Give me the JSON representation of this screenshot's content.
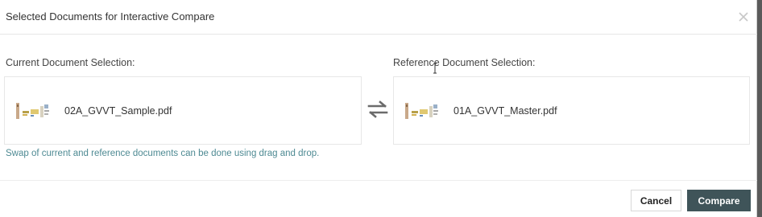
{
  "dialog": {
    "title": "Selected Documents for Interactive Compare",
    "close_icon": "close-icon"
  },
  "current": {
    "label": "Current Document Selection:",
    "file_name": "02A_GVVT_Sample.pdf"
  },
  "reference": {
    "label": "Reference Document Selection:",
    "file_name": "01A_GVVT_Master.pdf"
  },
  "swap_icon": "swap-arrows-icon",
  "hint": "Swap of current and reference documents can be done using drag and drop.",
  "buttons": {
    "cancel": "Cancel",
    "compare": "Compare"
  },
  "colors": {
    "hint_text": "#4e8a93",
    "compare_button": "#3f5459",
    "backdrop": "#5a5a5a"
  }
}
